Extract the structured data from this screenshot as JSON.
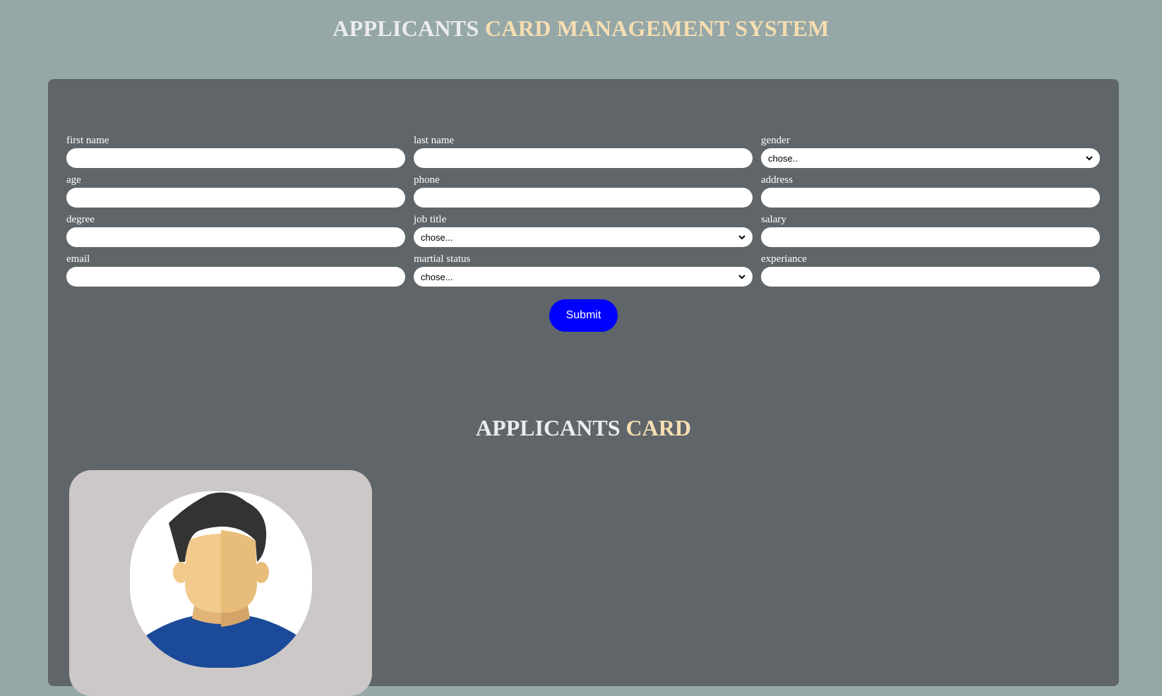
{
  "header": {
    "title_part1": "APPLICANTS",
    "title_part2": "CARD MANAGEMENT SYSTEM"
  },
  "form": {
    "fields": {
      "first_name": {
        "label": "first name",
        "value": ""
      },
      "last_name": {
        "label": "last name",
        "value": ""
      },
      "gender": {
        "label": "gender",
        "selected": "chose.."
      },
      "age": {
        "label": "age",
        "value": ""
      },
      "phone": {
        "label": "phone",
        "value": ""
      },
      "address": {
        "label": "address",
        "value": ""
      },
      "degree": {
        "label": "degree",
        "value": ""
      },
      "job_title": {
        "label": "job title",
        "selected": "chose..."
      },
      "salary": {
        "label": "salary",
        "value": ""
      },
      "email": {
        "label": "email",
        "value": ""
      },
      "martial_status": {
        "label": "martial status",
        "selected": "chose..."
      },
      "experiance": {
        "label": "experiance",
        "value": ""
      }
    },
    "submit_label": "Submit"
  },
  "cards_section": {
    "title_part1": "APPLICANTS",
    "title_part2": "CARD"
  },
  "icons": {
    "dropdown": "chevron-down-icon",
    "avatar": "user-avatar-icon"
  },
  "colors": {
    "page_background": "#95a7a7",
    "panel_background": "#5f6569",
    "title_text": "#ececec",
    "title_accent": "#f6deb1",
    "submit_button": "#0000ff",
    "card_background": "#cdc8c8",
    "avatar_hair": "#333333",
    "avatar_skin": "#f2cb8c",
    "avatar_shirt": "#1b4a99"
  }
}
